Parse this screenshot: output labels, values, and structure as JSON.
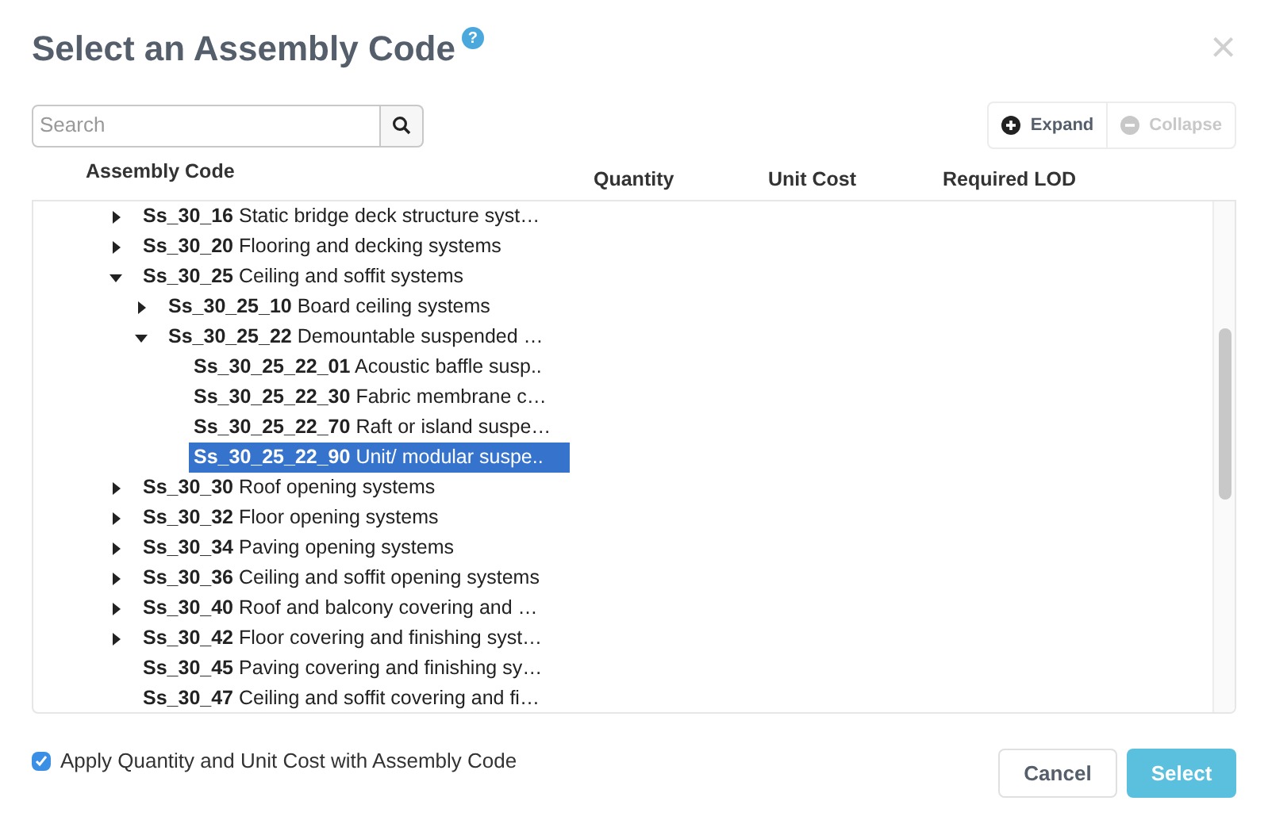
{
  "dialog": {
    "title": "Select an Assembly Code",
    "help_icon": "?",
    "close": "×"
  },
  "search": {
    "placeholder": "Search"
  },
  "toolbar": [
    {
      "label": "Expand",
      "kind": "expand",
      "disabled": false
    },
    {
      "label": "Collapse",
      "kind": "collapse",
      "disabled": true
    }
  ],
  "table": {
    "columns": [
      "Assembly Code",
      "Quantity",
      "Unit Cost",
      "Required LOD"
    ],
    "rows": [
      {
        "code": "Ss_30_16",
        "name": "Static bridge deck structure syst…",
        "kind": "branch",
        "expanded": false,
        "selected": false
      },
      {
        "code": "Ss_30_20",
        "name": "Flooring and decking systems",
        "kind": "branch",
        "expanded": false,
        "selected": false
      },
      {
        "code": "Ss_30_25",
        "name": "Ceiling and soffit systems",
        "kind": "branch",
        "expanded": true,
        "selected": false,
        "children": [
          {
            "code": "Ss_30_25_10",
            "name": "Board ceiling systems",
            "kind": "branch",
            "expanded": false,
            "selected": false
          },
          {
            "code": "Ss_30_25_22",
            "name": "Demountable suspended …",
            "kind": "branch",
            "expanded": true,
            "selected": false,
            "children": [
              {
                "code": "Ss_30_25_22_01",
                "name": "Acoustic baffle susp..",
                "kind": "leaf",
                "selected": false
              },
              {
                "code": "Ss_30_25_22_30",
                "name": "Fabric membrane c…",
                "kind": "leaf",
                "selected": false
              },
              {
                "code": "Ss_30_25_22_70",
                "name": "Raft or island suspe…",
                "kind": "leaf",
                "selected": false
              },
              {
                "code": "Ss_30_25_22_90",
                "name": "Unit/ modular suspe..",
                "kind": "leaf",
                "selected": true
              }
            ]
          }
        ]
      },
      {
        "code": "Ss_30_30",
        "name": "Roof opening systems",
        "kind": "branch",
        "expanded": false,
        "selected": false
      },
      {
        "code": "Ss_30_32",
        "name": "Floor opening systems",
        "kind": "branch",
        "expanded": false,
        "selected": false
      },
      {
        "code": "Ss_30_34",
        "name": "Paving opening systems",
        "kind": "branch",
        "expanded": false,
        "selected": false
      },
      {
        "code": "Ss_30_36",
        "name": "Ceiling and soffit opening systems",
        "kind": "branch",
        "expanded": false,
        "selected": false
      },
      {
        "code": "Ss_30_40",
        "name": "Roof and balcony covering and …",
        "kind": "branch",
        "expanded": false,
        "selected": false
      },
      {
        "code": "Ss_30_42",
        "name": "Floor covering and finishing syst…",
        "kind": "branch",
        "expanded": false,
        "selected": false
      },
      {
        "code": "Ss_30_45",
        "name": "Paving covering and finishing sy…",
        "kind": "leaf",
        "selected": false
      },
      {
        "code": "Ss_30_47",
        "name": "Ceiling and soffit covering and fi…",
        "kind": "leaf",
        "selected": false
      }
    ]
  },
  "apply_option": {
    "label": "Apply Quantity and Unit Cost with Assembly Code",
    "checked": true
  },
  "buttons": [
    {
      "label": "Cancel",
      "kind": "secondary"
    },
    {
      "label": "Select",
      "kind": "primary"
    }
  ]
}
